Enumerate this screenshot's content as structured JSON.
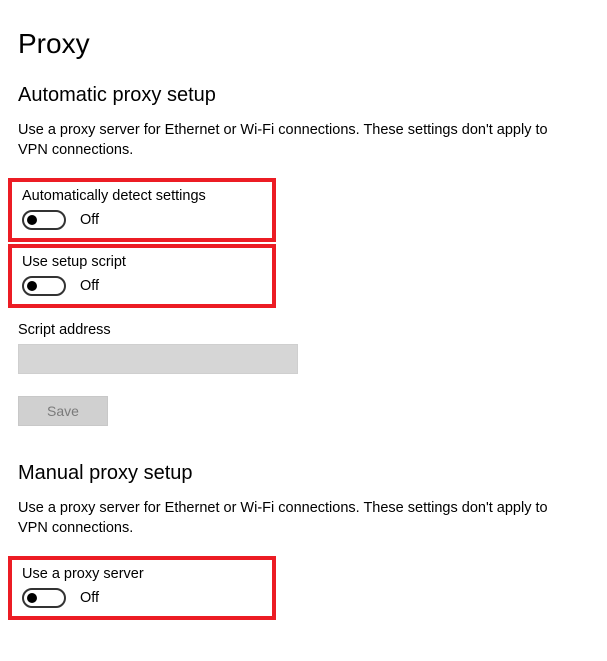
{
  "page": {
    "title": "Proxy"
  },
  "automatic": {
    "heading": "Automatic proxy setup",
    "description": "Use a proxy server for Ethernet or Wi-Fi connections. These settings don't apply to VPN connections.",
    "detect": {
      "label": "Automatically detect settings",
      "state": "Off"
    },
    "script": {
      "label": "Use setup script",
      "state": "Off"
    },
    "scriptAddress": {
      "label": "Script address",
      "value": ""
    },
    "save": "Save"
  },
  "manual": {
    "heading": "Manual proxy setup",
    "description": "Use a proxy server for Ethernet or Wi-Fi connections. These settings don't apply to VPN connections.",
    "useProxy": {
      "label": "Use a proxy server",
      "state": "Off"
    }
  }
}
